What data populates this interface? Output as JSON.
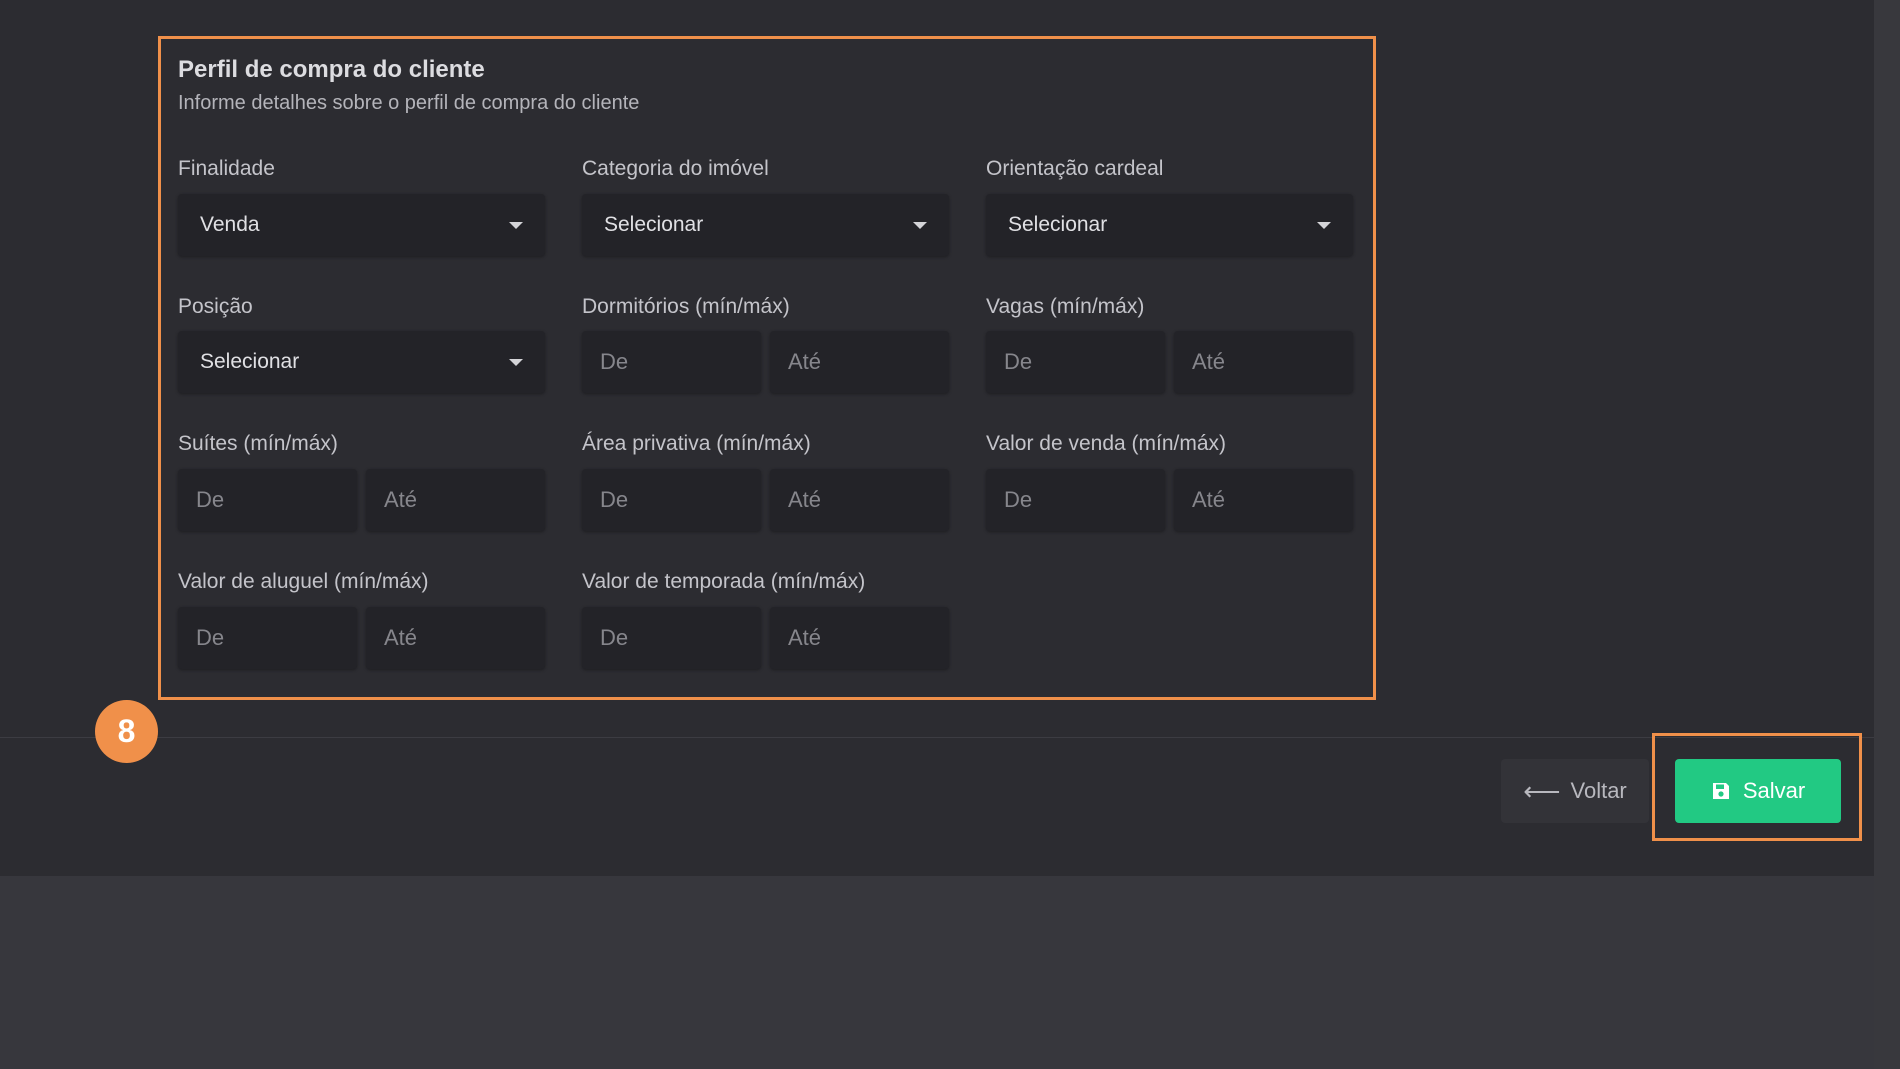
{
  "section": {
    "title": "Perfil de compra do cliente",
    "subtitle": "Informe detalhes sobre o perfil de compra do cliente"
  },
  "fields": {
    "finalidade": {
      "label": "Finalidade",
      "value": "Venda"
    },
    "categoria": {
      "label": "Categoria do imóvel",
      "value": "Selecionar"
    },
    "orientacao": {
      "label": "Orientação cardeal",
      "value": "Selecionar"
    },
    "posicao": {
      "label": "Posição",
      "value": "Selecionar"
    },
    "dormitorios": {
      "label": "Dormitórios (mín/máx)"
    },
    "vagas": {
      "label": "Vagas (mín/máx)"
    },
    "suites": {
      "label": "Suítes (mín/máx)"
    },
    "area": {
      "label": "Área privativa (mín/máx)"
    },
    "valor_venda": {
      "label": "Valor de venda (mín/máx)"
    },
    "valor_aluguel": {
      "label": "Valor de aluguel (mín/máx)"
    },
    "valor_temporada": {
      "label": "Valor de temporada (mín/máx)"
    }
  },
  "placeholders": {
    "min": "De",
    "max": "Até"
  },
  "step_badge": "8",
  "actions": {
    "back_label": "Voltar",
    "save_label": "Salvar"
  },
  "colors": {
    "highlight": "#f0904a",
    "save_button": "#22c983",
    "panel": "#2c2c31"
  },
  "icons": {
    "back": "arrow-left-icon",
    "save": "floppy-disk-icon",
    "dropdown": "caret-down-icon"
  }
}
